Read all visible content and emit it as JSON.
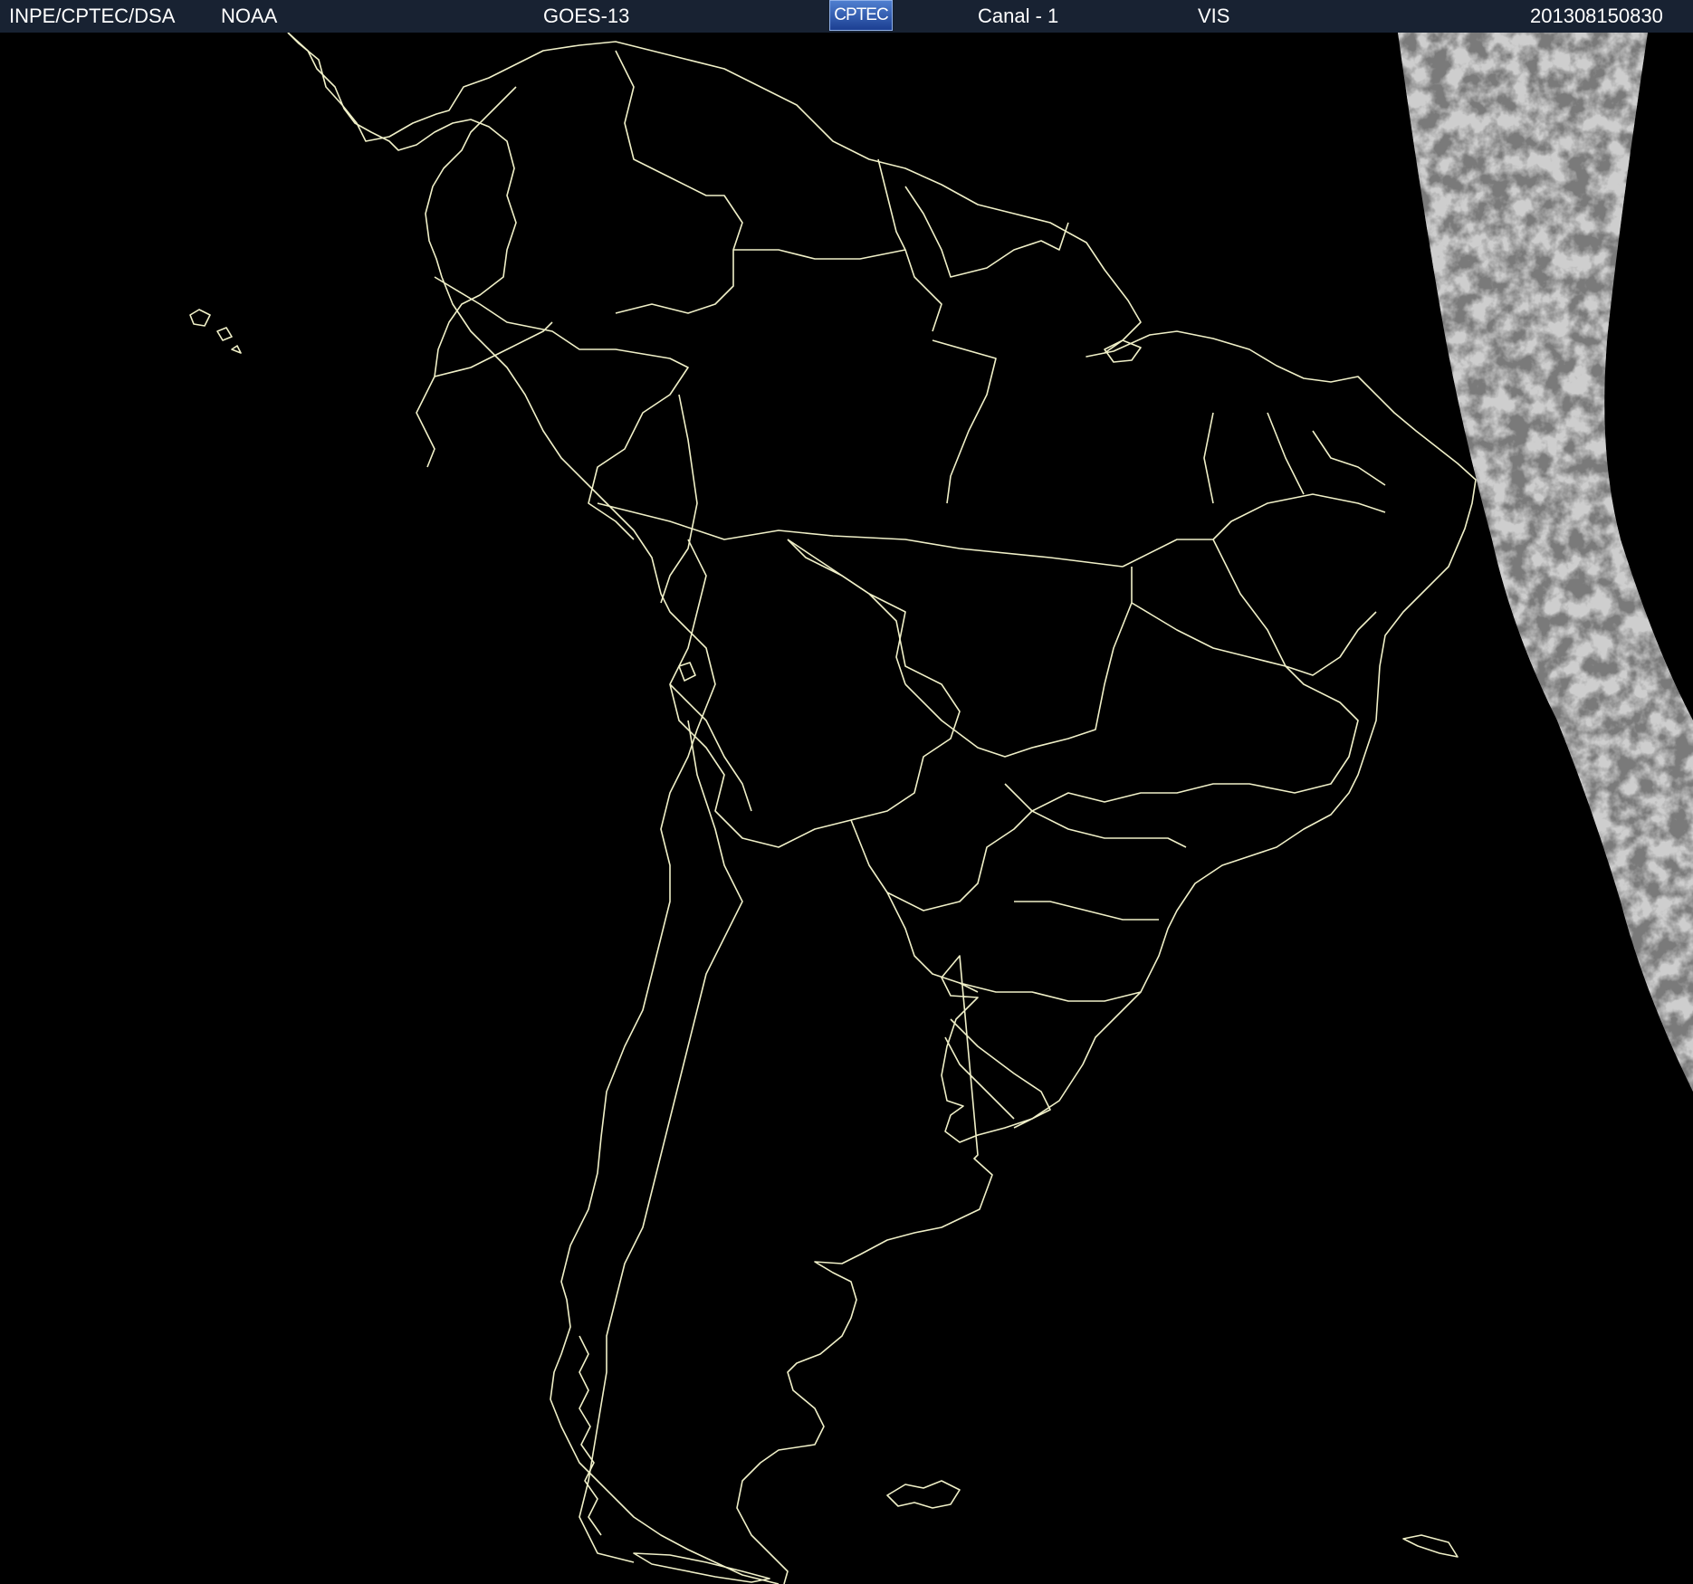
{
  "header": {
    "source": "INPE/CPTEC/DSA",
    "agency": "NOAA",
    "satellite": "GOES-13",
    "logo_text": "CPTEC",
    "channel": "Canal - 1",
    "band": "VIS",
    "timestamp": "201308150830"
  },
  "map": {
    "coastline_color": "#f0f0c8",
    "background_color": "#000000",
    "cloud_band_color": "#9a9a9a"
  }
}
